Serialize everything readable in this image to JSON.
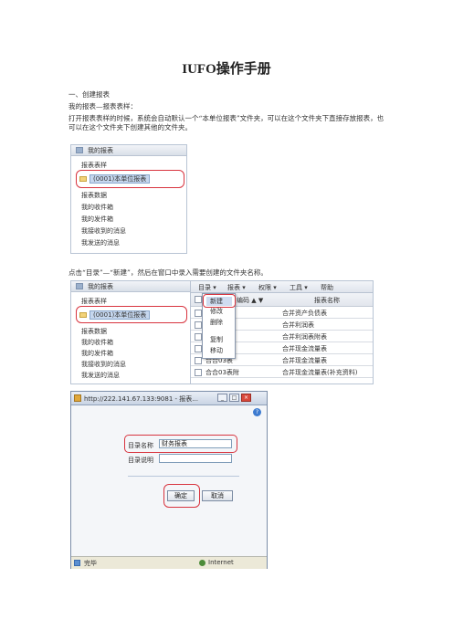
{
  "title": "IUFO操作手册",
  "section": "一、创建报表",
  "subheading": "我的报表—报表表样：",
  "intro": "打开报表表样的时候，系统会自动默认一个“本单位报表”文件夹，可以在这个文件夹下直接存放报表，也可以在这个文件夹下创建其他的文件夹。",
  "instruction": "点击“目录”—“新建”，然后在窗口中录入需要创建的文件夹名称。",
  "shot1": {
    "header": "我的报表",
    "items": [
      "报表表样",
      "(0001)本单位报表",
      "报表数据",
      "我的收件箱",
      "我的发件箱",
      "我接收到的消息",
      "我发送的消息"
    ]
  },
  "shot2": {
    "header": "我的报表",
    "items": [
      "报表表样",
      "(0001)本单位报表",
      "报表数据",
      "我的收件箱",
      "我的发件箱",
      "我接收到的消息",
      "我发送的消息"
    ],
    "menu": [
      "目录 ▾",
      "报表 ▾",
      "权限 ▾",
      "工具 ▾",
      "帮助"
    ],
    "dropdown": [
      "新建",
      "修改",
      "删除",
      "复制",
      "移动"
    ],
    "col_code": "编码 ▲ ▼",
    "col_name": "报表名称",
    "rows": [
      {
        "code": "",
        "name": "合并资产负债表"
      },
      {
        "code": "",
        "name": "合并利润表"
      },
      {
        "code": "",
        "name": "合并利润表附表"
      },
      {
        "code": "",
        "name": "合并现金流量表"
      },
      {
        "code": "合合03表",
        "name": "合并现金流量表"
      },
      {
        "code": "合合03表附",
        "name": "合并现金流量表(补充资料)"
      }
    ]
  },
  "dialog": {
    "titlebar": "http://222.141.67.133:9081 - 报表...",
    "dir_name_label": "目录名称",
    "dir_name_value": "财务报表",
    "dir_desc_label": "目录说明",
    "ok": "确定",
    "cancel": "取消",
    "status_left": "完毕",
    "status_right": "Internet"
  }
}
